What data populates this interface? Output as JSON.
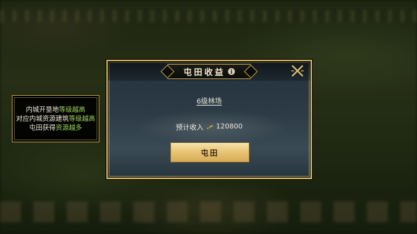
{
  "tip": {
    "line1_plain": "内城开垦地",
    "line1_highlight": "等级越高",
    "line2_plain": "对应内城资源建筑",
    "line2_highlight": "等级越高",
    "line3_plain": "屯田获得",
    "line3_highlight": "资源越多",
    "highlight_color": "#9bd05a"
  },
  "dialog": {
    "title": "屯田收益",
    "info_icon": "info-icon",
    "close_icon": "close-icon",
    "level_label": "6级林场",
    "income_label": "预计收入",
    "income_icon": "resource-icon",
    "income_value": "120800",
    "confirm_label": "屯田",
    "border_color": "#d5b45e"
  }
}
